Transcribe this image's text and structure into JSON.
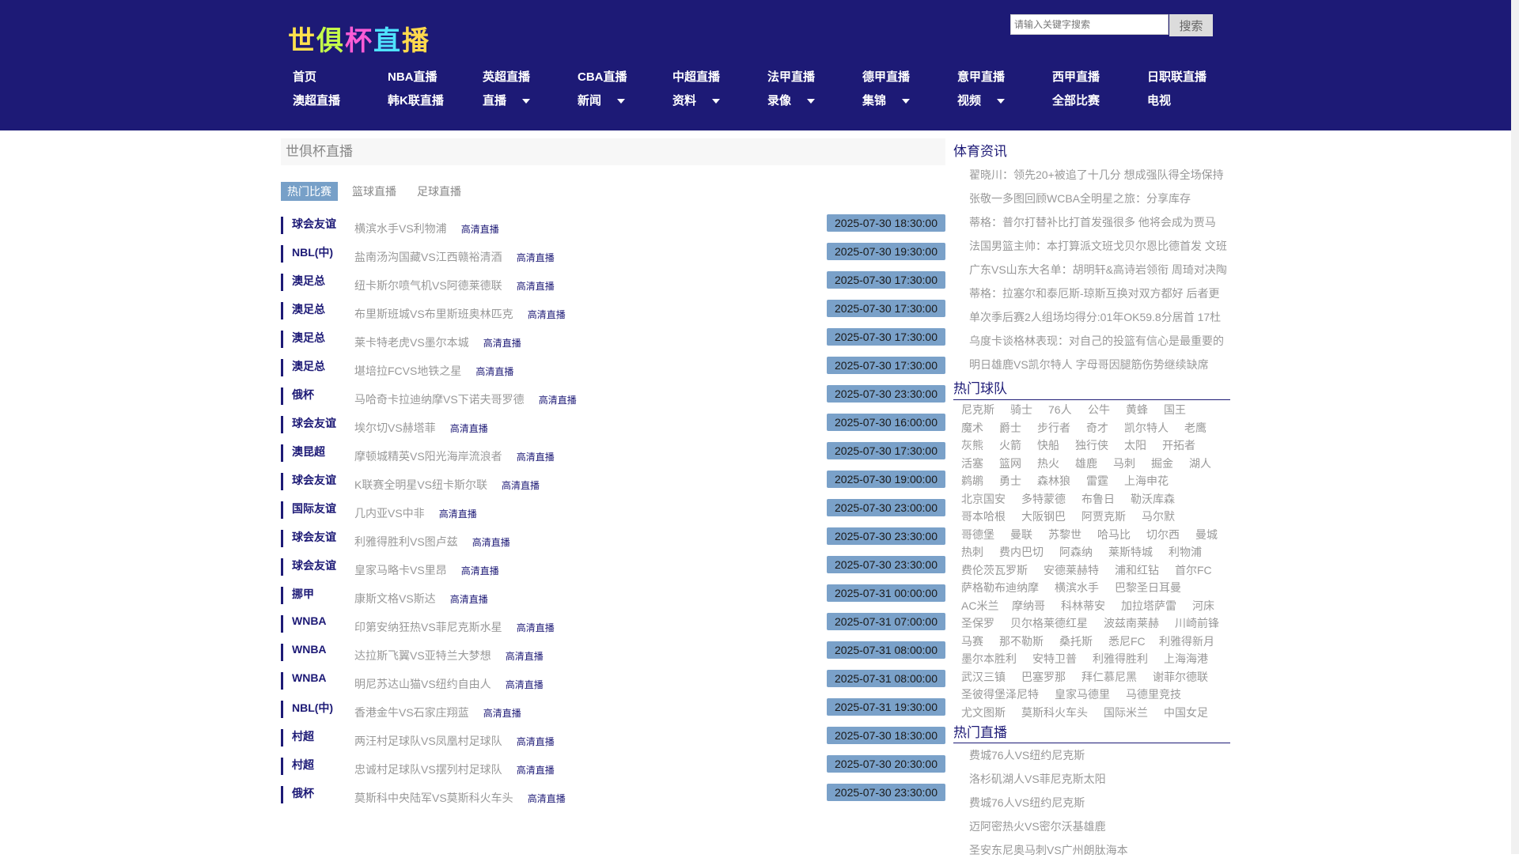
{
  "logo": {
    "text": "世俱杯直播"
  },
  "search": {
    "placeholder": "请输入关键字搜索",
    "button_label": "搜索"
  },
  "nav": {
    "row1": [
      "首页",
      "NBA直播",
      "英超直播",
      "CBA直播",
      "中超直播",
      "法甲直播",
      "德甲直播",
      "意甲直播",
      "西甲直播",
      "日职联直播"
    ],
    "row2": [
      {
        "label": "澳超直播",
        "dropdown": false
      },
      {
        "label": "韩K联直播",
        "dropdown": false
      },
      {
        "label": "直播",
        "dropdown": true
      },
      {
        "label": "新闻",
        "dropdown": true
      },
      {
        "label": "资料",
        "dropdown": true
      },
      {
        "label": "录像",
        "dropdown": true
      },
      {
        "label": "集锦",
        "dropdown": true
      },
      {
        "label": "视频",
        "dropdown": true
      },
      {
        "label": "全部比赛",
        "dropdown": false
      },
      {
        "label": "电视",
        "dropdown": false
      }
    ]
  },
  "main": {
    "title": "世俱杯直播",
    "tabs": [
      {
        "label": "热门比赛",
        "active": true
      },
      {
        "label": "篮球直播",
        "active": false
      },
      {
        "label": "足球直播",
        "active": false
      }
    ],
    "matches": [
      {
        "league": "球会友谊",
        "teams": "横滨水手VS利物浦",
        "link": "高清直播",
        "time": "2025-07-30 18:30:00"
      },
      {
        "league": "NBL(中)",
        "teams": "盐南汤沟国藏VS江西赣裕清酒",
        "link": "高清直播",
        "time": "2025-07-30 19:30:00"
      },
      {
        "league": "澳足总",
        "teams": "纽卡斯尔喷气机VS阿德莱德联",
        "link": "高清直播",
        "time": "2025-07-30 17:30:00"
      },
      {
        "league": "澳足总",
        "teams": "布里斯班城VS布里斯班奥林匹克",
        "link": "高清直播",
        "time": "2025-07-30 17:30:00"
      },
      {
        "league": "澳足总",
        "teams": "莱卡特老虎VS墨尔本城",
        "link": "高清直播",
        "time": "2025-07-30 17:30:00"
      },
      {
        "league": "澳足总",
        "teams": "堪培拉FCVS地铁之星",
        "link": "高清直播",
        "time": "2025-07-30 17:30:00"
      },
      {
        "league": "俄杯",
        "teams": "马哈奇卡拉迪纳摩VS下诺夫哥罗德",
        "link": "高清直播",
        "time": "2025-07-30 23:30:00"
      },
      {
        "league": "球会友谊",
        "teams": "埃尔切VS赫塔菲",
        "link": "高清直播",
        "time": "2025-07-30 16:00:00"
      },
      {
        "league": "澳昆超",
        "teams": "摩顿城精英VS阳光海岸流浪者",
        "link": "高清直播",
        "time": "2025-07-30 17:30:00"
      },
      {
        "league": "球会友谊",
        "teams": "K联赛全明星VS纽卡斯尔联",
        "link": "高清直播",
        "time": "2025-07-30 19:00:00"
      },
      {
        "league": "国际友谊",
        "teams": "几内亚VS中非",
        "link": "高清直播",
        "time": "2025-07-30 23:00:00"
      },
      {
        "league": "球会友谊",
        "teams": "利雅得胜利VS图卢兹",
        "link": "高清直播",
        "time": "2025-07-30 23:30:00"
      },
      {
        "league": "球会友谊",
        "teams": "皇家马略卡VS里昂",
        "link": "高清直播",
        "time": "2025-07-30 23:30:00"
      },
      {
        "league": "挪甲",
        "teams": "康斯文格VS斯达",
        "link": "高清直播",
        "time": "2025-07-31 00:00:00"
      },
      {
        "league": "WNBA",
        "teams": "印第安纳狂热VS菲尼克斯水星",
        "link": "高清直播",
        "time": "2025-07-31 07:00:00"
      },
      {
        "league": "WNBA",
        "teams": "达拉斯飞翼VS亚特兰大梦想",
        "link": "高清直播",
        "time": "2025-07-31 08:00:00"
      },
      {
        "league": "WNBA",
        "teams": "明尼苏达山猫VS纽约自由人",
        "link": "高清直播",
        "time": "2025-07-31 08:00:00"
      },
      {
        "league": "NBL(中)",
        "teams": "香港金牛VS石家庄翔蓝",
        "link": "高清直播",
        "time": "2025-07-31 19:30:00"
      },
      {
        "league": "村超",
        "teams": "两汪村足球队VS凤凰村足球队",
        "link": "高清直播",
        "time": "2025-07-30 18:30:00"
      },
      {
        "league": "村超",
        "teams": "忠诚村足球队VS摆列村足球队",
        "link": "高清直播",
        "time": "2025-07-30 20:30:00"
      },
      {
        "league": "俄杯",
        "teams": "莫斯科中央陆军VS莫斯科火车头",
        "link": "高清直播",
        "time": "2025-07-30 23:30:00"
      }
    ]
  },
  "sidebar": {
    "news_title": "体育资讯",
    "news": [
      "翟晓川：领先20+被追了十几分 想成强队得全场保持",
      "张敬一多图回顾WCBA全明星之旅：分享库存",
      "蒂格：普尔打替补比打首发强很多 他将会成为贾马",
      "法国男篮主帅：本打算派文班戈贝尔恩比德首发 文班",
      "广东VS山东大名单：胡明轩&高诗岩领衔 周琦对决陶",
      "蒂格：拉塞尔和泰厄斯-琼斯互换对双方都好 后者更",
      "单次季后赛2人组场均得分:01年OK59.8分居首 17杜",
      "乌度卡谈格林表现：对自己的投篮有信心是最重要的",
      "明日雄鹿VS凯尔特人 字母哥因腿筋伤势继续缺席"
    ],
    "teams_title": "热门球队",
    "teams": [
      [
        "尼克斯",
        "骑士",
        "76人",
        "公牛",
        "黄蜂",
        "国王"
      ],
      [
        "魔术",
        "爵士",
        "步行者",
        "奇才",
        "凯尔特人",
        "老鹰"
      ],
      [
        "灰熊",
        "火箭",
        "快船",
        "独行侠",
        "太阳",
        "开拓者"
      ],
      [
        "活塞",
        "篮网",
        "热火",
        "雄鹿",
        "马刺",
        "掘金",
        "湖人"
      ],
      [
        "鹈鹕",
        "勇士",
        "森林狼",
        "雷霆",
        "上海申花"
      ],
      [
        "北京国安",
        "多特蒙德",
        "布鲁日",
        "勒沃库森"
      ],
      [
        "哥本哈根",
        "大阪钢巴",
        "阿贾克斯",
        "马尔默"
      ],
      [
        "哥德堡",
        "曼联",
        "苏黎世",
        "哈马比",
        "切尔西",
        "曼城"
      ],
      [
        "热刺",
        "费内巴切",
        "阿森纳",
        "莱斯特城",
        "利物浦"
      ],
      [
        "费伦茨瓦罗斯",
        "安德莱赫特",
        "浦和红钻",
        "首尔FC"
      ],
      [
        "萨格勒布迪纳摩",
        "横滨水手",
        "巴黎圣日耳曼"
      ],
      [
        "AC米兰",
        "摩纳哥",
        "科林蒂安",
        "加拉塔萨雷",
        "河床"
      ],
      [
        "圣保罗",
        "贝尔格莱德红星",
        "波兹南莱赫",
        "川崎前锋"
      ],
      [
        "马赛",
        "那不勒斯",
        "桑托斯",
        "悉尼FC",
        "利雅得新月"
      ],
      [
        "墨尔本胜利",
        "安特卫普",
        "利雅得胜利",
        "上海海港"
      ],
      [
        "武汉三镇",
        "巴塞罗那",
        "拜仁慕尼黑",
        "谢菲尔德联"
      ],
      [
        "圣彼得堡泽尼特",
        "皇家马德里",
        "马德里竞技"
      ],
      [
        "尤文图斯",
        "莫斯科火车头",
        "国际米兰",
        "中国女足"
      ]
    ],
    "live_title": "热门直播",
    "live": [
      "费城76人VS纽约尼克斯",
      "洛杉矶湖人VS菲尼克斯太阳",
      "费城76人VS纽约尼克斯",
      "迈阿密热火VS密尔沃基雄鹿",
      "圣安东尼奥马刺VS广州朗肽海本"
    ]
  },
  "colors": {
    "header_bg": "#1d1a76",
    "time_badge": "#7aa1c9",
    "tab_active": "#77a0c8",
    "logo": [
      "#ffe14d",
      "#c5ff4a",
      "#ff5cd6",
      "#4fe3ff",
      "#ffd94d"
    ]
  }
}
